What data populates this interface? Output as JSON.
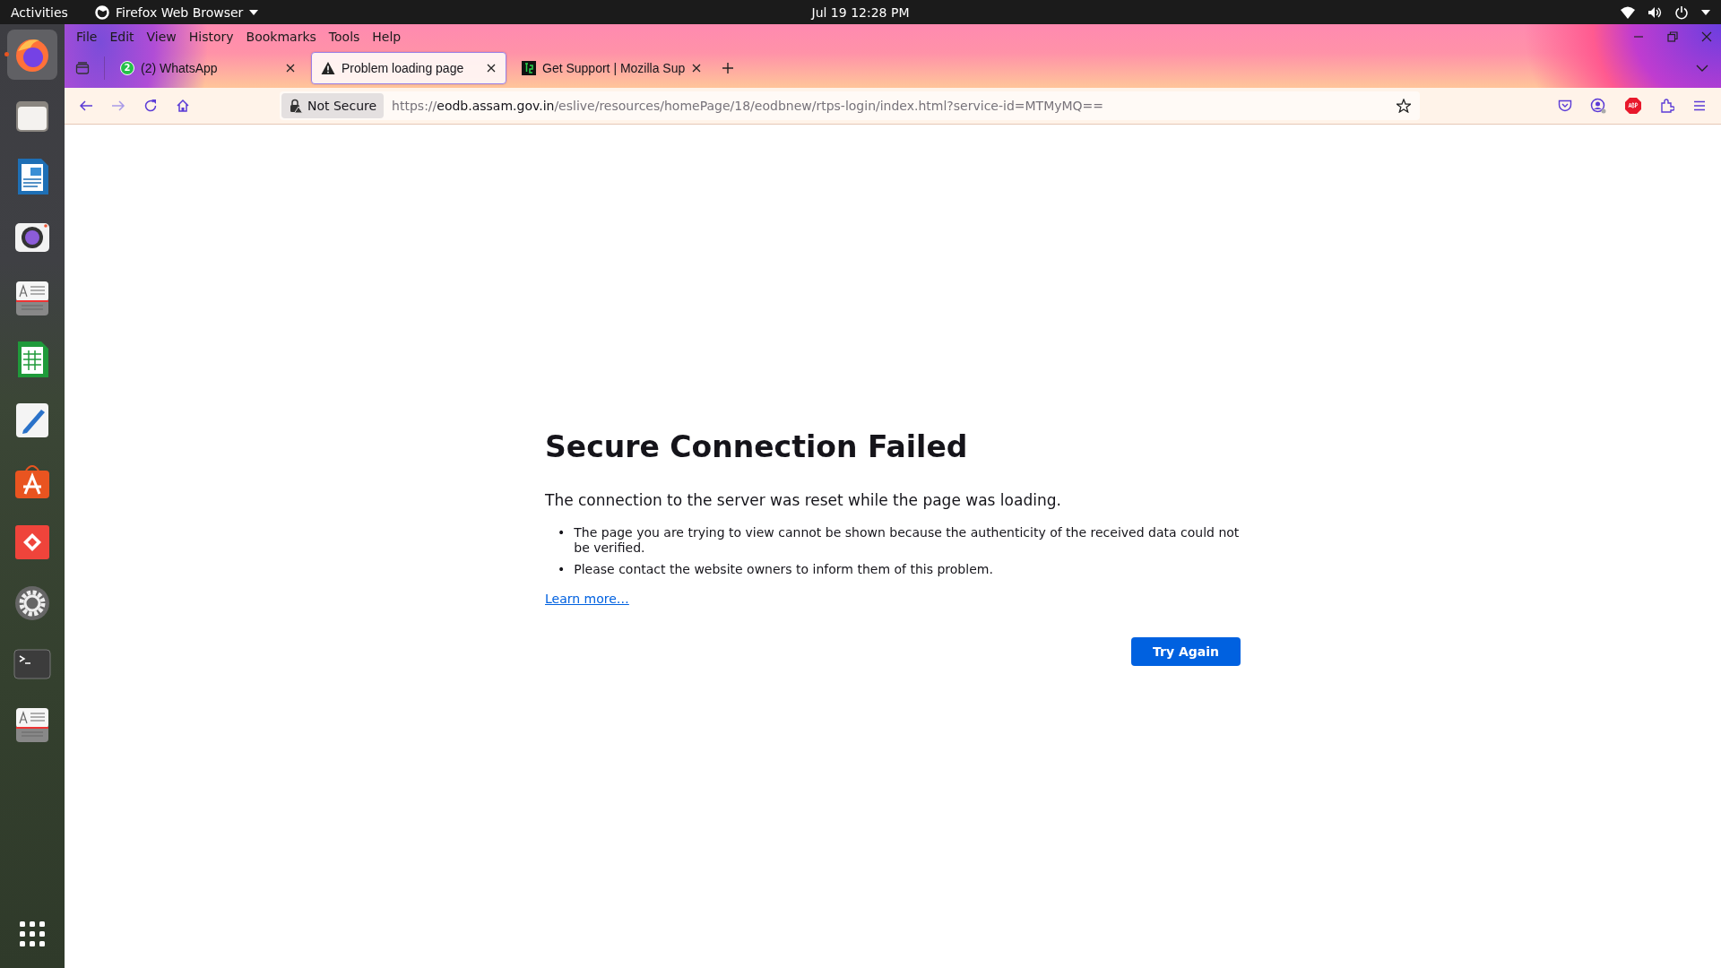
{
  "top_bar": {
    "activities": "Activities",
    "app_menu": "Firefox Web Browser",
    "clock": "Jul 19  12:28 PM"
  },
  "dock": [
    {
      "kind": "firefox",
      "running": true
    },
    {
      "kind": "files",
      "running": false
    },
    {
      "kind": "writer",
      "running": false
    },
    {
      "kind": "camera",
      "running": false
    },
    {
      "kind": "reader",
      "running": false
    },
    {
      "kind": "calc",
      "running": false
    },
    {
      "kind": "editor",
      "running": false
    },
    {
      "kind": "store",
      "running": false
    },
    {
      "kind": "remote",
      "running": false
    },
    {
      "kind": "settings",
      "running": false
    },
    {
      "kind": "terminal",
      "running": false
    },
    {
      "kind": "reader",
      "running": false
    }
  ],
  "menu_bar": [
    "File",
    "Edit",
    "View",
    "History",
    "Bookmarks",
    "Tools",
    "Help"
  ],
  "tabs": [
    {
      "label": "(2) WhatsApp",
      "badge": "2",
      "kind": "chat",
      "selected": false
    },
    {
      "label": "Problem loading page",
      "kind": "warning",
      "selected": true
    },
    {
      "label": "Get Support | Mozilla Sup",
      "kind": "site",
      "selected": false
    }
  ],
  "address_bar": {
    "security": "Not Secure",
    "scheme": "https://",
    "host": "eodb.assam.gov.in",
    "path": "/eslive/resources/homePage/18/eodbnew/rtps-login/index.html?service-id=MTMyMQ=="
  },
  "error_page": {
    "title": "Secure Connection Failed",
    "message": "The connection to the server was reset while the page was loading.",
    "bullet_marker": "•",
    "bullets": [
      "The page you are trying to view cannot be shown because the authenticity of the received data could not be verified.",
      "Please contact the website owners to inform them of this problem."
    ],
    "link": "Learn more…",
    "button": "Try Again"
  }
}
